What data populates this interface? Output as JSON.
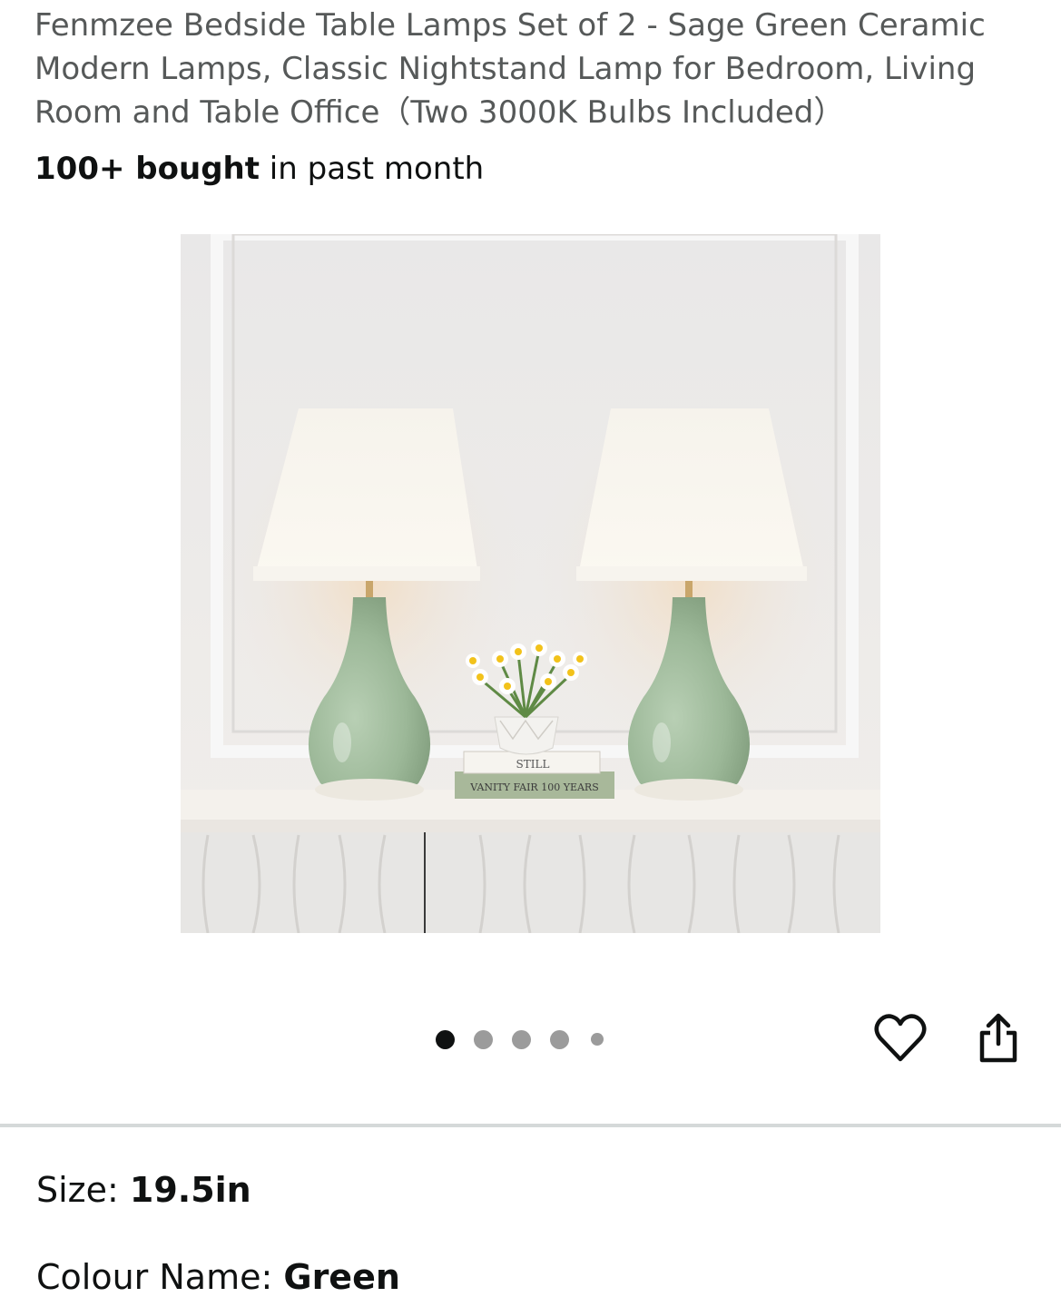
{
  "product": {
    "title": "Fenmzee Bedside Table Lamps Set of 2 - Sage Green Ceramic Modern Lamps, Classic Nightstand Lamp for Bedroom, Living Room and Table Office（Two 3000K Bulbs Included）",
    "bought_bold": "100+ bought",
    "bought_rest": " in past month"
  },
  "image": {
    "book_top": "STILL",
    "book_bottom": "VANITY FAIR 100 YEARS"
  },
  "carousel": {
    "count": 5,
    "active_index": 0
  },
  "icons": {
    "favorite": "heart-icon",
    "share": "share-icon"
  },
  "variations": {
    "size_label": "Size: ",
    "size_value": "19.5in",
    "colour_label": "Colour Name: ",
    "colour_value": "Green"
  },
  "colors": {
    "title_text": "#565959",
    "body_text": "#0f1111",
    "lamp_base": "#9db99a",
    "dot_inactive": "#9b9b9b",
    "divider": "#d5d9d9"
  }
}
